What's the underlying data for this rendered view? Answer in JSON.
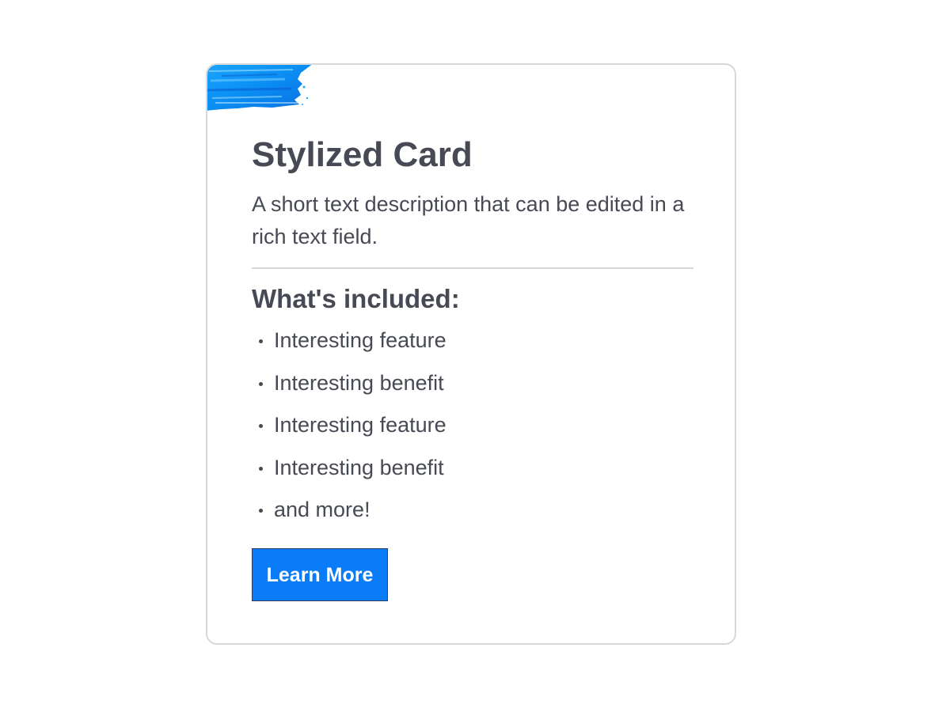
{
  "card": {
    "title": "Stylized Card",
    "description": "A short text description that can be edited in a rich text field.",
    "subtitle": "What's included:",
    "features": [
      "Interesting feature",
      "Interesting benefit",
      "Interesting feature",
      "Interesting benefit",
      "and more!"
    ],
    "button_label": "Learn More"
  },
  "colors": {
    "accent": "#0a7cf8",
    "text": "#474a55",
    "border": "#d8d8dc",
    "brush": "#0a8df2"
  },
  "icons": {
    "brush": "paint-brush-stroke-icon",
    "bullet": "bullet-point-icon"
  }
}
